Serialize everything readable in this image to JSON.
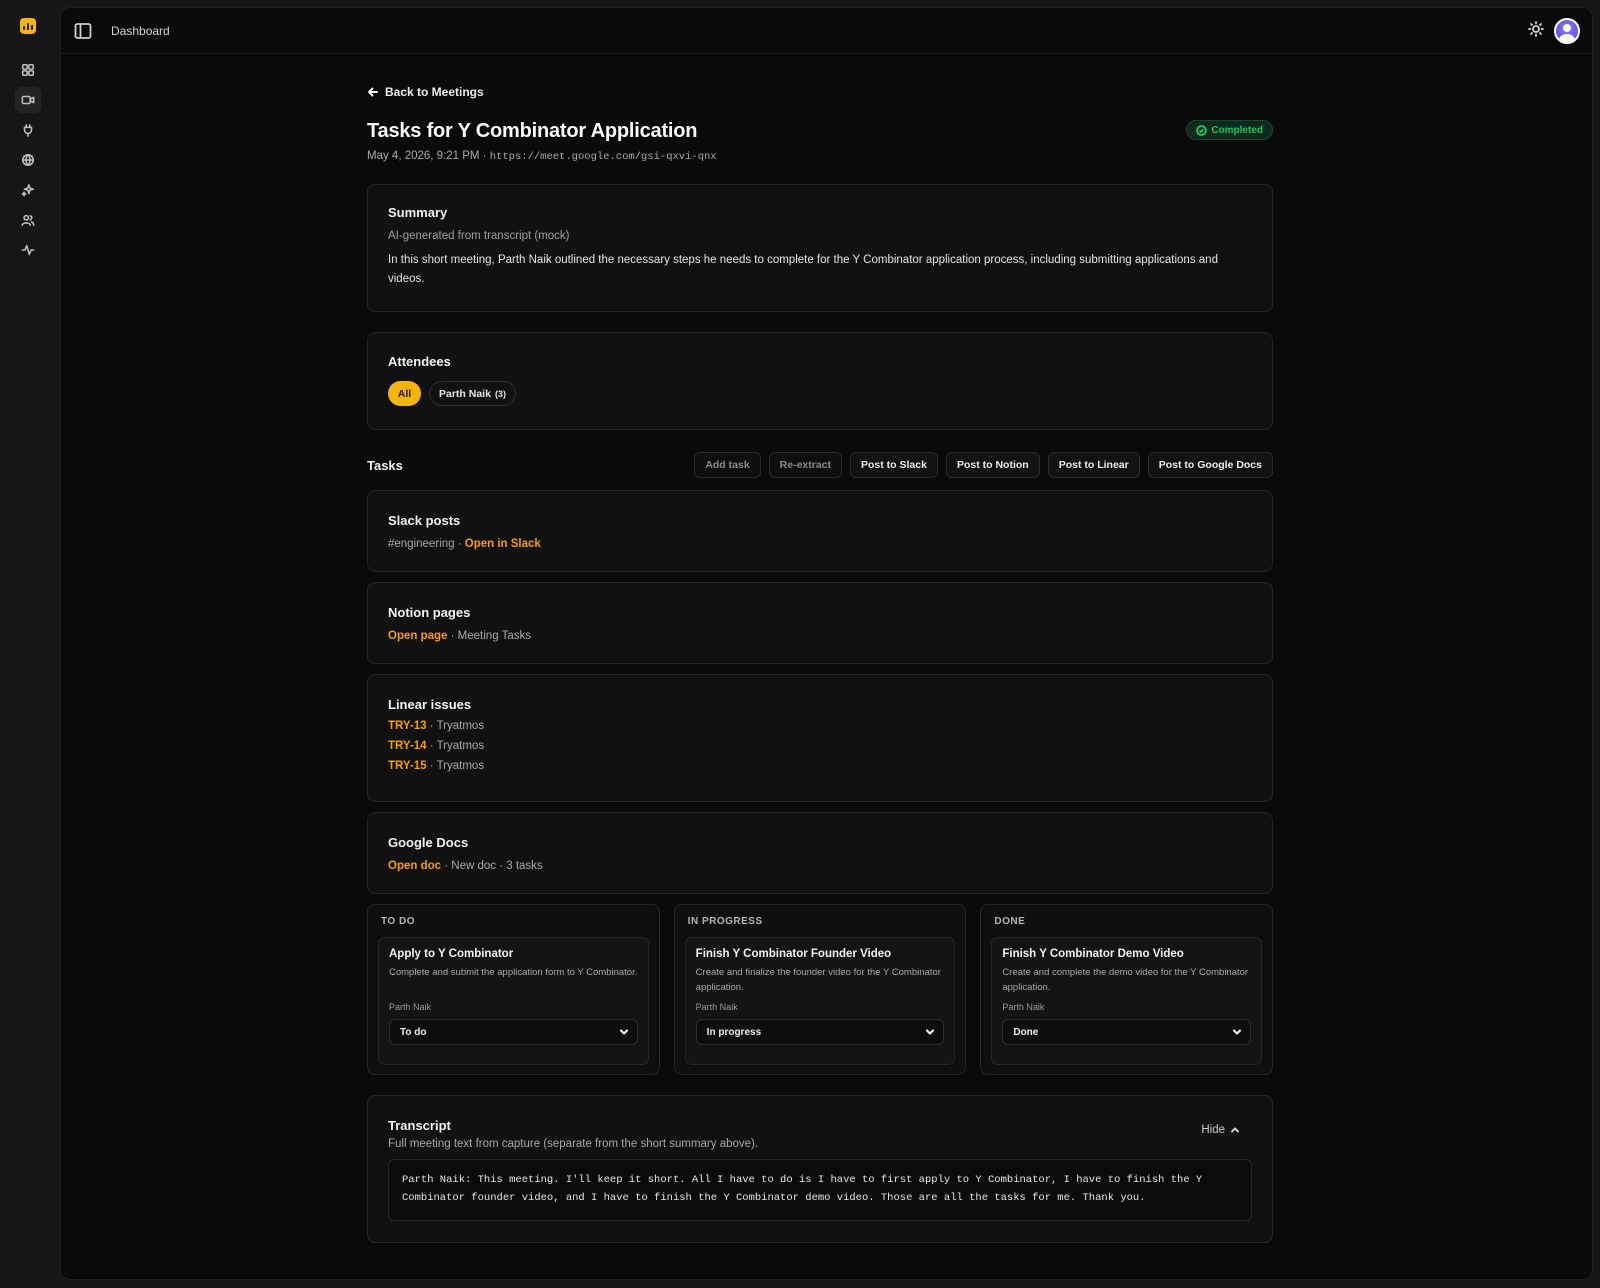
{
  "topbar": {
    "title": "Dashboard"
  },
  "nav": {
    "icons": [
      "dashboard-grid-icon",
      "video-icon",
      "plug-icon",
      "globe-icon",
      "sparkles-icon",
      "users-icon",
      "activity-icon"
    ]
  },
  "colors": {
    "accent": "#f5b409",
    "link": "#f59e0b",
    "success": "#22c55e"
  },
  "back_link": "Back to Meetings",
  "meeting": {
    "title": "Tasks for Y Combinator Application",
    "status": "Completed",
    "datetime": "May 4, 2026, 9:21 PM",
    "separator": "·",
    "url": "https://meet.google.com/gsi-qxvi-qnx"
  },
  "summary": {
    "heading": "Summary",
    "subtitle": "AI-generated from transcript (mock)",
    "body": "In this short meeting, Parth Naik outlined the necessary steps he needs to complete for the Y Combinator application process, including submitting applications and videos."
  },
  "attendees": {
    "heading": "Attendees",
    "all_label": "All",
    "people": [
      {
        "name": "Parth Naik",
        "count": "(3)"
      }
    ]
  },
  "tasks": {
    "heading": "Tasks",
    "buttons": {
      "add": "Add task",
      "reextract": "Re-extract",
      "slack": "Post to Slack",
      "notion": "Post to Notion",
      "linear": "Post to Linear",
      "gdocs": "Post to Google Docs"
    }
  },
  "slack": {
    "heading": "Slack posts",
    "channel": "#engineering",
    "sep": " · ",
    "link": "Open in Slack"
  },
  "notion": {
    "heading": "Notion pages",
    "link": "Open page",
    "sep": " · ",
    "page": "Meeting Tasks"
  },
  "linear": {
    "heading": "Linear issues",
    "issues": [
      {
        "id": "TRY-13",
        "team": "Tryatmos"
      },
      {
        "id": "TRY-14",
        "team": "Tryatmos"
      },
      {
        "id": "TRY-15",
        "team": "Tryatmos"
      }
    ],
    "sep": " · "
  },
  "gdocs": {
    "heading": "Google Docs",
    "link": "Open doc",
    "sep": " · ",
    "info": "New doc · 3 tasks"
  },
  "board": {
    "columns": [
      {
        "header": "TO DO",
        "card": {
          "title": "Apply to Y Combinator",
          "desc": "Complete and submit the application form to Y Combinator.",
          "owner": "Parth Naik",
          "status": "To do"
        }
      },
      {
        "header": "IN PROGRESS",
        "card": {
          "title": "Finish Y Combinator Founder Video",
          "desc": "Create and finalize the founder video for the Y Combinator application.",
          "owner": "Parth Naik",
          "status": "In progress"
        }
      },
      {
        "header": "DONE",
        "card": {
          "title": "Finish Y Combinator Demo Video",
          "desc": "Create and complete the demo video for the Y Combinator application.",
          "owner": "Parth Naik",
          "status": "Done"
        }
      }
    ]
  },
  "transcript": {
    "heading": "Transcript",
    "subtitle": "Full meeting text from capture (separate from the short summary above).",
    "toggle": "Hide",
    "text": "Parth Naik: This meeting. I'll keep it short. All I have to do is I have to first apply to Y Combinator, I have to finish the Y Combinator founder video, and I have to finish the Y Combinator demo video. Those are all the tasks for me. Thank you."
  }
}
